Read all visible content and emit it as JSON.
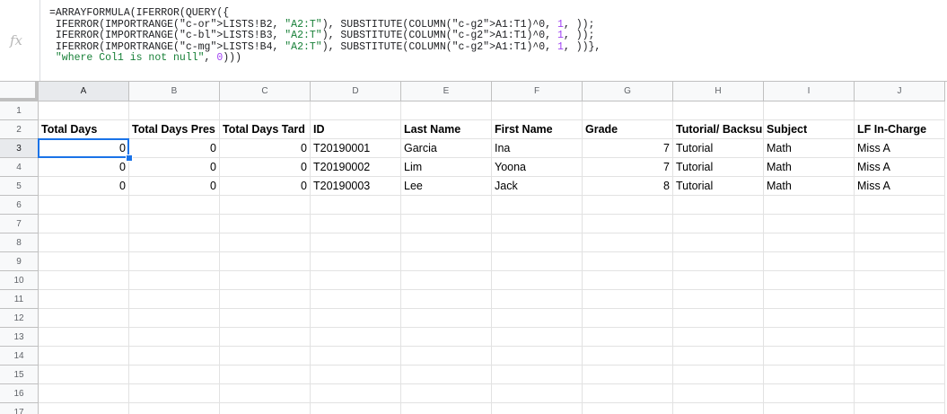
{
  "formula_bar": {
    "icon": "fx-icon",
    "fx_label": "fx",
    "formula_lines": [
      "=ARRAYFORMULA(IFERROR(QUERY({",
      " IFERROR(IMPORTRANGE(LISTS!B2, \"A2:T\"), SUBSTITUTE(COLUMN(A1:T1)^0, 1, ));",
      " IFERROR(IMPORTRANGE(LISTS!B3, \"A2:T\"), SUBSTITUTE(COLUMN(A1:T1)^0, 1, ));",
      " IFERROR(IMPORTRANGE(LISTS!B4, \"A2:T\"), SUBSTITUTE(COLUMN(A1:T1)^0, 1, ))},",
      " \"where Col1 is not null\", 0)))"
    ]
  },
  "columns": [
    "A",
    "B",
    "C",
    "D",
    "E",
    "F",
    "G",
    "H",
    "I",
    "J"
  ],
  "rows": [
    "1",
    "2",
    "3",
    "4",
    "5",
    "6",
    "7",
    "8",
    "9",
    "10",
    "11",
    "12",
    "13",
    "14",
    "15",
    "16",
    "17"
  ],
  "selected": {
    "column": "A",
    "row": "3"
  },
  "headers": [
    "Total Days",
    "Total Days Pres",
    "Total Days Tard",
    "ID",
    "Last Name",
    "First Name",
    "Grade",
    "Tutorial/ Backsu",
    "Subject",
    "LF In-Charge"
  ],
  "data_rows": [
    [
      "0",
      "0",
      "0",
      "T20190001",
      "Garcia",
      "Ina",
      "7",
      "Tutorial",
      "Math",
      "Miss A"
    ],
    [
      "0",
      "0",
      "0",
      "T20190002",
      "Lim",
      "Yoona",
      "7",
      "Tutorial",
      "Math",
      "Miss A"
    ],
    [
      "0",
      "0",
      "0",
      "T20190003",
      "Lee",
      "Jack",
      "8",
      "Tutorial",
      "Math",
      "Miss A"
    ]
  ],
  "right_aligned_columns": [
    0,
    1,
    2,
    6
  ]
}
